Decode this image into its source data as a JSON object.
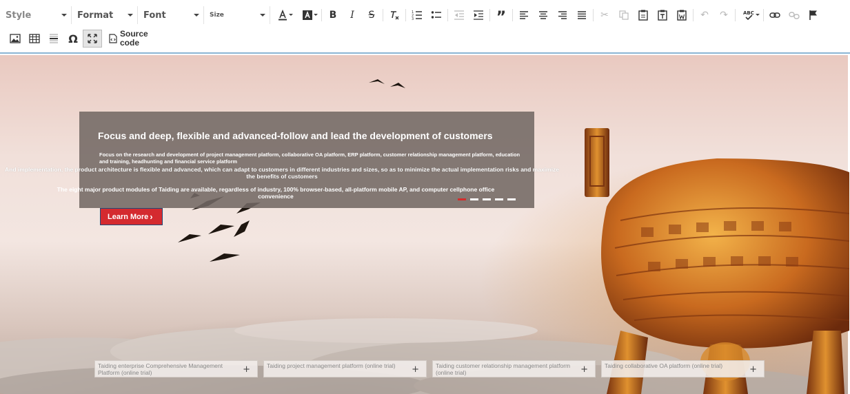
{
  "toolbar": {
    "style_label": "Style",
    "format_label": "Format",
    "font_label": "Font",
    "size_label": "Size",
    "source_label": "Source code"
  },
  "banner": {
    "headline": "Focus and deep, flexible and advanced-follow and lead the development of customers",
    "desc1": "Focus on the research and development of project management platform, collaborative OA platform, ERP platform, customer relationship management platform, education and training, headhunting and financial service platform",
    "desc2": "And implementation, the product architecture is flexible and advanced, which can adapt to customers in different industries and sizes, so as to minimize the actual implementation risks and maximize the benefits of customers",
    "desc3": "The eight major product modules of Taiding are available, regardless of industry, 100% browser-based, all-platform mobile AP, and computer cellphone office convenience",
    "learn_more": "Learn More",
    "learn_more_arrow": "›",
    "slide_count": 5,
    "active_slide": 1
  },
  "cards": [
    {
      "text": "Taiding enterprise Comprehensive Management Platform (online trial)",
      "plus": "+"
    },
    {
      "text": "Taiding project management platform (online trial)",
      "plus": "+"
    },
    {
      "text": "Taiding customer relationship management platform (online trial)",
      "plus": "+"
    },
    {
      "text": "Taiding collaborative OA platform (online trial)",
      "plus": "+"
    }
  ],
  "colors": {
    "accent": "#d42a2f",
    "toolbar_border": "#8bb5d4"
  }
}
